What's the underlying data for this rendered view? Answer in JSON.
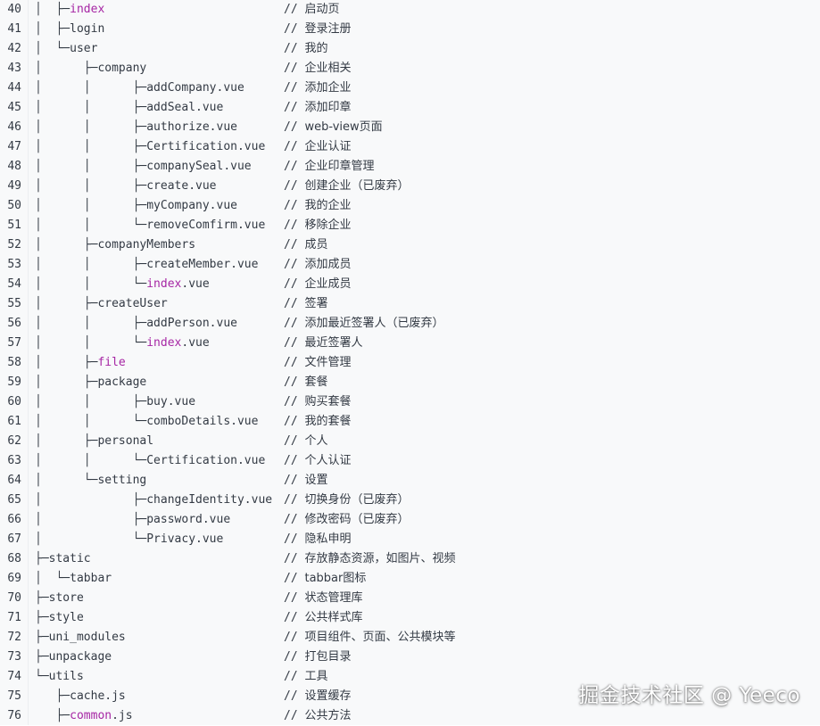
{
  "colors": {
    "background": "#f8f9fa",
    "text": "#333a44",
    "keyword": "#a626a4"
  },
  "code": {
    "lines": [
      {
        "no": "40",
        "prefix": "│  ├─",
        "name": "index",
        "suffix": "",
        "keyword": true,
        "slashes": "// ",
        "comment": "启动页"
      },
      {
        "no": "41",
        "prefix": "│  ├─",
        "name": "login",
        "suffix": "",
        "keyword": false,
        "slashes": "// ",
        "comment": "登录注册"
      },
      {
        "no": "42",
        "prefix": "│  └─",
        "name": "user",
        "suffix": "",
        "keyword": false,
        "slashes": "// ",
        "comment": "我的"
      },
      {
        "no": "43",
        "prefix": "│      ├─",
        "name": "company",
        "suffix": "",
        "keyword": false,
        "slashes": "// ",
        "comment": "企业相关"
      },
      {
        "no": "44",
        "prefix": "│      │      ├─",
        "name": "addCompany.vue",
        "suffix": "",
        "keyword": false,
        "slashes": "// ",
        "comment": "添加企业"
      },
      {
        "no": "45",
        "prefix": "│      │      ├─",
        "name": "addSeal.vue",
        "suffix": "",
        "keyword": false,
        "slashes": "// ",
        "comment": "添加印章"
      },
      {
        "no": "46",
        "prefix": "│      │      ├─",
        "name": "authorize.vue",
        "suffix": "",
        "keyword": false,
        "slashes": "// ",
        "comment": "web-view页面"
      },
      {
        "no": "47",
        "prefix": "│      │      ├─",
        "name": "Certification.vue",
        "suffix": "",
        "keyword": false,
        "slashes": "// ",
        "comment": "企业认证"
      },
      {
        "no": "48",
        "prefix": "│      │      ├─",
        "name": "companySeal.vue",
        "suffix": "",
        "keyword": false,
        "slashes": "// ",
        "comment": "企业印章管理"
      },
      {
        "no": "49",
        "prefix": "│      │      ├─",
        "name": "create.vue",
        "suffix": "",
        "keyword": false,
        "slashes": "// ",
        "comment": "创建企业（已废弃）"
      },
      {
        "no": "50",
        "prefix": "│      │      ├─",
        "name": "myCompany.vue",
        "suffix": "",
        "keyword": false,
        "slashes": "// ",
        "comment": "我的企业"
      },
      {
        "no": "51",
        "prefix": "│      │      └─",
        "name": "removeComfirm.vue",
        "suffix": "",
        "keyword": false,
        "slashes": "// ",
        "comment": "移除企业"
      },
      {
        "no": "52",
        "prefix": "│      ├─",
        "name": "companyMembers",
        "suffix": "",
        "keyword": false,
        "slashes": "// ",
        "comment": "成员"
      },
      {
        "no": "53",
        "prefix": "│      │      ├─",
        "name": "createMember.vue",
        "suffix": "",
        "keyword": false,
        "slashes": "// ",
        "comment": "添加成员"
      },
      {
        "no": "54",
        "prefix": "│      │      └─",
        "name": "index",
        "suffix": ".vue",
        "keyword": true,
        "slashes": "// ",
        "comment": "企业成员"
      },
      {
        "no": "55",
        "prefix": "│      ├─",
        "name": "createUser",
        "suffix": "",
        "keyword": false,
        "slashes": "// ",
        "comment": "签署"
      },
      {
        "no": "56",
        "prefix": "│      │      ├─",
        "name": "addPerson.vue",
        "suffix": "",
        "keyword": false,
        "slashes": "// ",
        "comment": "添加最近签署人（已废弃）"
      },
      {
        "no": "57",
        "prefix": "│      │      └─",
        "name": "index",
        "suffix": ".vue",
        "keyword": true,
        "slashes": "// ",
        "comment": "最近签署人"
      },
      {
        "no": "58",
        "prefix": "│      ├─",
        "name": "file",
        "suffix": "",
        "keyword": true,
        "slashes": "// ",
        "comment": "文件管理"
      },
      {
        "no": "59",
        "prefix": "│      ├─",
        "name": "package",
        "suffix": "",
        "keyword": false,
        "slashes": "// ",
        "comment": "套餐"
      },
      {
        "no": "60",
        "prefix": "│      │      ├─",
        "name": "buy.vue",
        "suffix": "",
        "keyword": false,
        "slashes": "// ",
        "comment": "购买套餐"
      },
      {
        "no": "61",
        "prefix": "│      │      └─",
        "name": "comboDetails.vue",
        "suffix": "",
        "keyword": false,
        "slashes": "// ",
        "comment": "我的套餐"
      },
      {
        "no": "62",
        "prefix": "│      ├─",
        "name": "personal",
        "suffix": "",
        "keyword": false,
        "slashes": "// ",
        "comment": "个人"
      },
      {
        "no": "63",
        "prefix": "│      │      └─",
        "name": "Certification.vue",
        "suffix": "",
        "keyword": false,
        "slashes": "// ",
        "comment": "个人认证"
      },
      {
        "no": "64",
        "prefix": "│      └─",
        "name": "setting",
        "suffix": "",
        "keyword": false,
        "slashes": "// ",
        "comment": "设置"
      },
      {
        "no": "65",
        "prefix": "│             ├─",
        "name": "changeIdentity.vue",
        "suffix": "",
        "keyword": false,
        "slashes": "// ",
        "comment": "切换身份（已废弃）"
      },
      {
        "no": "66",
        "prefix": "│             ├─",
        "name": "password.vue",
        "suffix": "",
        "keyword": false,
        "slashes": "// ",
        "comment": "修改密码（已废弃）"
      },
      {
        "no": "67",
        "prefix": "│             └─",
        "name": "Privacy.vue",
        "suffix": "",
        "keyword": false,
        "slashes": "// ",
        "comment": "隐私申明"
      },
      {
        "no": "68",
        "prefix": "├─",
        "name": "static",
        "suffix": "",
        "keyword": false,
        "slashes": "// ",
        "comment": "存放静态资源，如图片、视频"
      },
      {
        "no": "69",
        "prefix": "│  └─",
        "name": "tabbar",
        "suffix": "",
        "keyword": false,
        "slashes": "// ",
        "comment": "tabbar图标"
      },
      {
        "no": "70",
        "prefix": "├─",
        "name": "store",
        "suffix": "",
        "keyword": false,
        "slashes": "// ",
        "comment": "状态管理库"
      },
      {
        "no": "71",
        "prefix": "├─",
        "name": "style",
        "suffix": "",
        "keyword": false,
        "slashes": "// ",
        "comment": "公共样式库"
      },
      {
        "no": "72",
        "prefix": "├─",
        "name": "uni_modules",
        "suffix": "",
        "keyword": false,
        "slashes": "// ",
        "comment": "项目组件、页面、公共模块等"
      },
      {
        "no": "73",
        "prefix": "├─",
        "name": "unpackage",
        "suffix": "",
        "keyword": false,
        "slashes": "// ",
        "comment": "打包目录"
      },
      {
        "no": "74",
        "prefix": "└─",
        "name": "utils",
        "suffix": "",
        "keyword": false,
        "slashes": "// ",
        "comment": "工具"
      },
      {
        "no": "75",
        "prefix": "   ├─",
        "name": "cache.js",
        "suffix": "",
        "keyword": false,
        "slashes": "// ",
        "comment": "设置缓存"
      },
      {
        "no": "76",
        "prefix": "   ├─",
        "name": "common",
        "suffix": ".js",
        "keyword": true,
        "slashes": "// ",
        "comment": "公共方法"
      }
    ]
  },
  "watermark": {
    "text": "掘金技术社区 @ Yeeco"
  }
}
